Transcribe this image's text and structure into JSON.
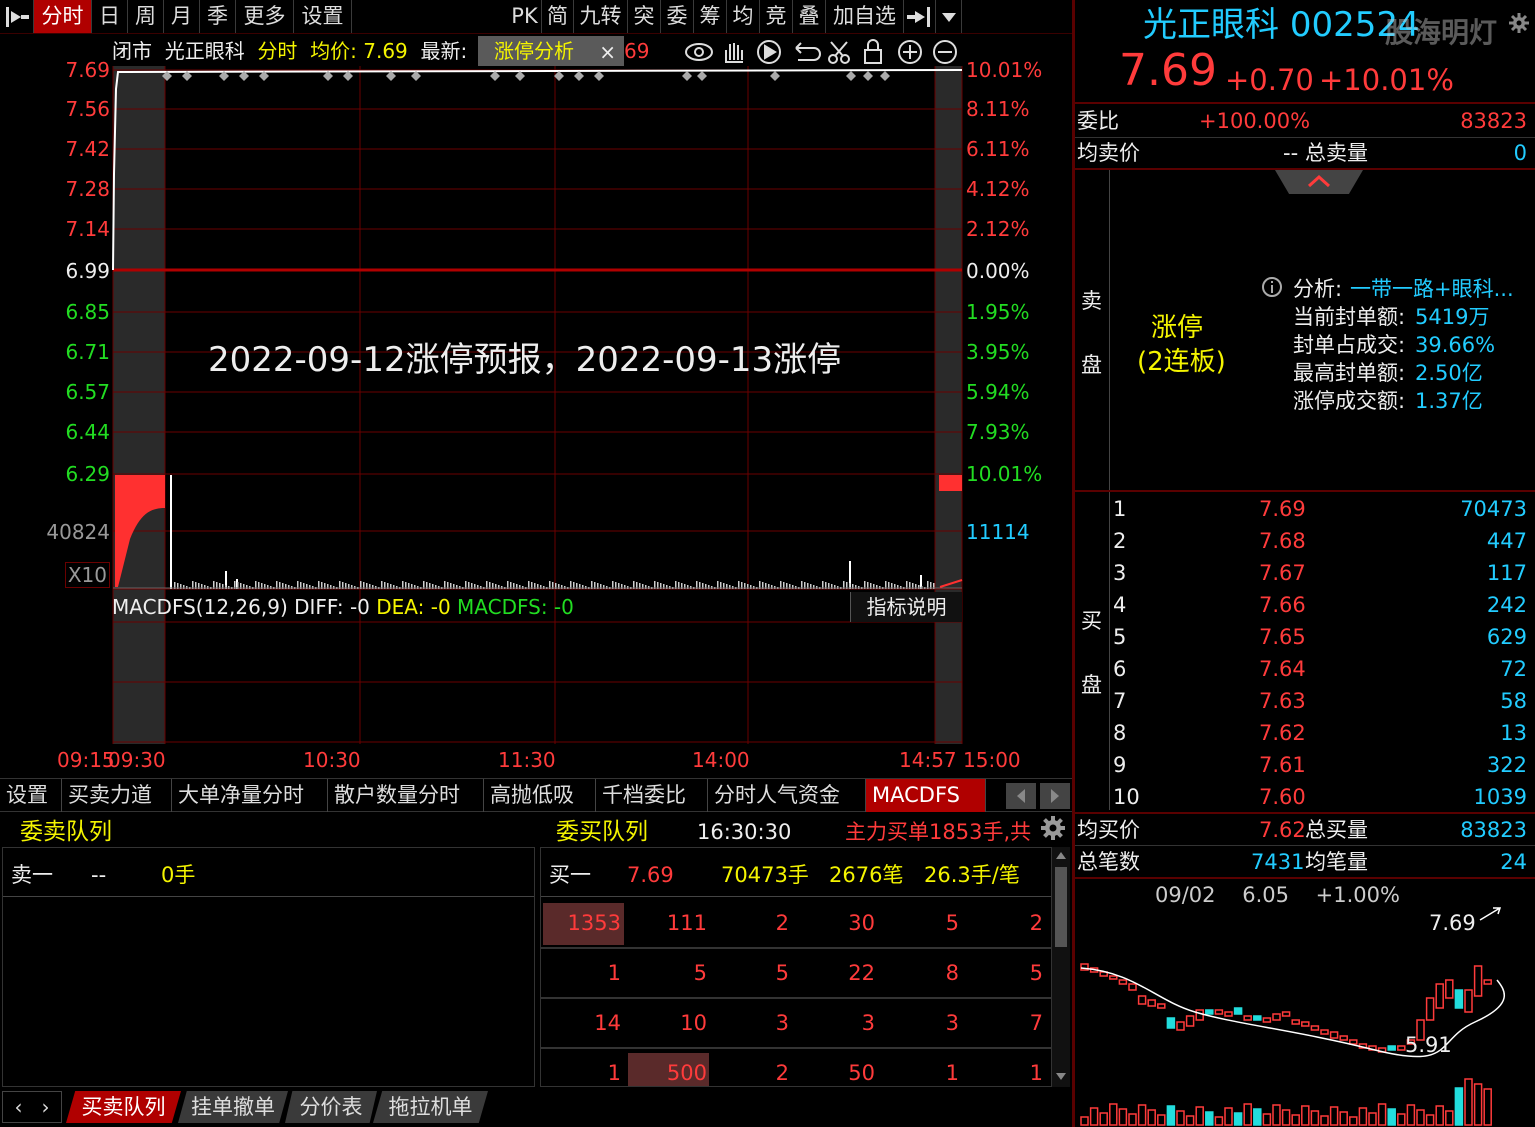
{
  "toolbar": {
    "tabs": [
      "分时",
      "日",
      "周",
      "月",
      "季",
      "更多",
      "设置"
    ],
    "tools": [
      "PK",
      "简",
      "九转",
      "突",
      "委",
      "筹",
      "均",
      "竞",
      "叠",
      "加自选"
    ]
  },
  "chart": {
    "status": "闭市",
    "name": "光正眼科",
    "mode": "分时",
    "avg_label": "均价: 7.69",
    "latest_label": "最新:",
    "popup_label": "涨停分析",
    "popup_close": "×",
    "latest_value": "69",
    "annotation": "2022-09-12涨停预报，2022-09-13涨停",
    "price_ticks": [
      "7.69",
      "7.56",
      "7.42",
      "7.28",
      "7.14",
      "6.99",
      "6.85",
      "6.71",
      "6.57",
      "6.44",
      "6.29"
    ],
    "pct_ticks": [
      "10.01%",
      "8.11%",
      "6.11%",
      "4.12%",
      "2.12%",
      "0.00%",
      "1.95%",
      "3.95%",
      "5.94%",
      "7.93%",
      "10.01%"
    ],
    "vol_left": "40824",
    "vol_right": "11114",
    "vol_mult": "X10",
    "macd_name": "MACDFS(12,26,9)",
    "macd_diff": "DIFF: -0",
    "macd_dea": "DEA: -0",
    "macd_val": "MACDFS: -0",
    "macd_help": "指标说明",
    "time_ticks": [
      "09:15",
      "09:30",
      "10:30",
      "11:30",
      "14:00",
      "14:57",
      "15:00"
    ]
  },
  "bottom_tabs": [
    "设置",
    "买卖力道",
    "大单净量分时",
    "散户数量分时",
    "高抛低吸",
    "千档委比",
    "分时人气资金",
    "MACDFS"
  ],
  "queue": {
    "sell_title": "委卖队列",
    "buy_title": "委买队列",
    "time": "16:30:30",
    "main_buy": "主力买单1853手,共",
    "sell_row": {
      "label": "卖一",
      "price": "--",
      "qty": "0手"
    },
    "buy_row": {
      "label": "买一",
      "price": "7.69",
      "qty": "70473手",
      "count": "2676笔",
      "avg": "26.3手/笔"
    },
    "grid": [
      [
        "1353",
        "111",
        "2",
        "30",
        "5",
        "2"
      ],
      [
        "1",
        "5",
        "5",
        "22",
        "8",
        "5"
      ],
      [
        "14",
        "10",
        "3",
        "3",
        "3",
        "7"
      ],
      [
        "1",
        "500",
        "2",
        "50",
        "1",
        "1"
      ]
    ],
    "bottom_tabs": [
      "买卖队列",
      "挂单撤单",
      "分价表",
      "拖拉机单"
    ]
  },
  "quote": {
    "name": "光正眼科",
    "code": "002524",
    "watermark": "股海明灯",
    "price": "7.69",
    "change": "+0.70",
    "change_pct": "+10.01%",
    "weibi_label": "委比",
    "weibi_value": "+100.00%",
    "weibi_diff": "83823",
    "avg_sell_label": "均卖价",
    "avg_sell_value": "--",
    "total_sell_label": "总卖量",
    "total_sell_value": "0",
    "limit_up": "涨停",
    "limit_up_days": "(2连板)",
    "analysis_label": "分析:",
    "analysis_value": "一带一路+眼科...",
    "analysis_rows": [
      {
        "label": "当前封单额:",
        "value": "5419万"
      },
      {
        "label": "封单占成交:",
        "value": "39.66%"
      },
      {
        "label": "最高封单额:",
        "value": "2.50亿"
      },
      {
        "label": "涨停成交额:",
        "value": "1.37亿"
      }
    ],
    "sell_side": [
      "卖",
      "盘"
    ],
    "buy_side": [
      "买",
      "盘"
    ],
    "bids": [
      {
        "lvl": "1",
        "price": "7.69",
        "vol": "70473"
      },
      {
        "lvl": "2",
        "price": "7.68",
        "vol": "447"
      },
      {
        "lvl": "3",
        "price": "7.67",
        "vol": "117"
      },
      {
        "lvl": "4",
        "price": "7.66",
        "vol": "242"
      },
      {
        "lvl": "5",
        "price": "7.65",
        "vol": "629"
      },
      {
        "lvl": "6",
        "price": "7.64",
        "vol": "72"
      },
      {
        "lvl": "7",
        "price": "7.63",
        "vol": "58"
      },
      {
        "lvl": "8",
        "price": "7.62",
        "vol": "13"
      },
      {
        "lvl": "9",
        "price": "7.61",
        "vol": "322"
      },
      {
        "lvl": "10",
        "price": "7.60",
        "vol": "1039"
      }
    ],
    "avg_buy_label": "均买价",
    "avg_buy_value": "7.62",
    "total_buy_label": "总买量",
    "total_buy_value": "83823",
    "trades_label": "总笔数",
    "trades_value": "7431",
    "avg_trade_label": "均笔量",
    "avg_trade_value": "24",
    "kline_header": "09/02    6.05    +1.00%",
    "kline_high": "7.69",
    "kline_low": "5.91"
  },
  "colors": {
    "up": "#ff3b3b",
    "down": "#22dd22",
    "accent": "#b00000",
    "cyan": "#22ccff",
    "yellow": "#f4f400"
  }
}
